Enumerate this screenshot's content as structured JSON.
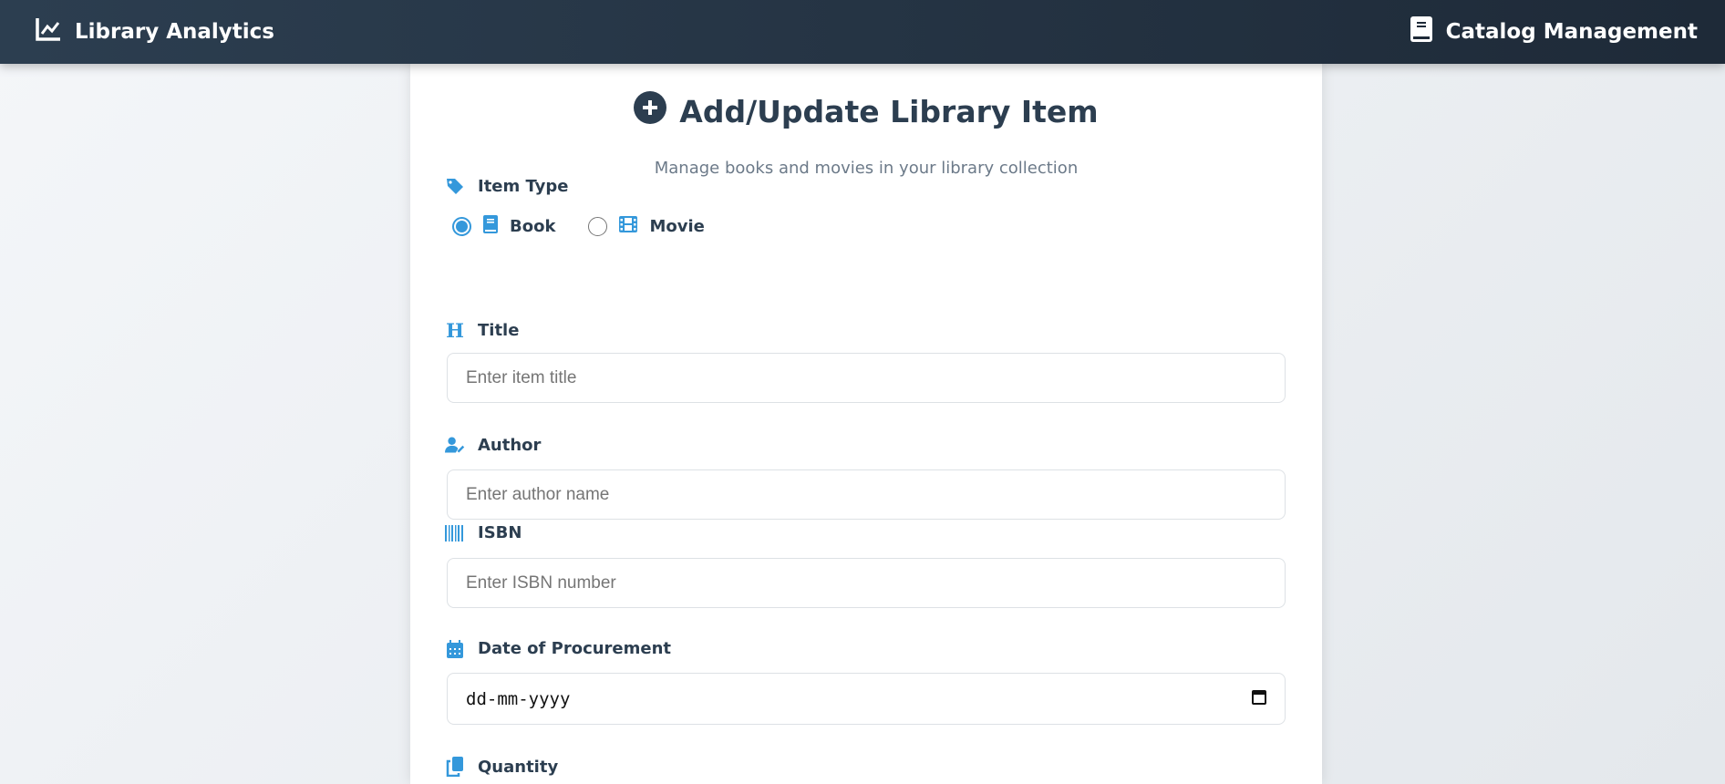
{
  "header": {
    "brand": "Library Analytics",
    "nav_link": "Catalog Management"
  },
  "form": {
    "title": "Add/Update Library Item",
    "subtitle": "Manage books and movies in your library collection",
    "item_type": {
      "label": "Item Type",
      "options": [
        {
          "label": "Book",
          "selected": true
        },
        {
          "label": "Movie",
          "selected": false
        }
      ]
    },
    "title_field": {
      "label": "Title",
      "placeholder": "Enter item title"
    },
    "author_field": {
      "label": "Author",
      "placeholder": "Enter author name"
    },
    "isbn_field": {
      "label": "ISBN",
      "placeholder": "Enter ISBN number"
    },
    "date_field": {
      "label": "Date of Procurement",
      "placeholder": "dd-mm-yyyy"
    },
    "quantity_field": {
      "label": "Quantity"
    }
  },
  "colors": {
    "accent": "#3498db",
    "header": "#2c3e50"
  }
}
